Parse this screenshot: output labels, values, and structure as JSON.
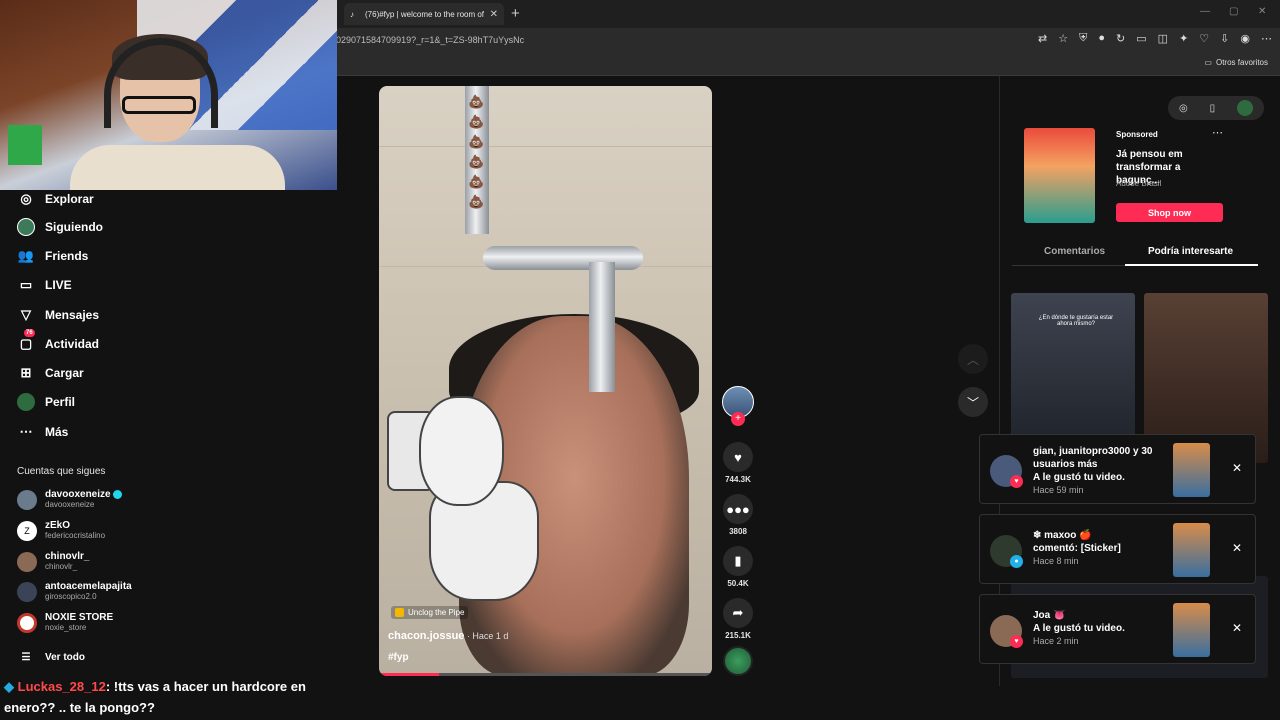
{
  "browser": {
    "tab_title": "(76)#fyp | welcome to the room of",
    "url": "029071584709919?_r=1&_t=ZS-98hT7uYysNc",
    "bookmarks_folder": "Otros favoritos"
  },
  "sidebar": {
    "items": [
      {
        "label": "Explorar",
        "icon": "compass-icon"
      },
      {
        "label": "Siguiendo",
        "icon": "following-avatar-icon"
      },
      {
        "label": "Friends",
        "icon": "friends-icon"
      },
      {
        "label": "LIVE",
        "icon": "live-icon"
      },
      {
        "label": "Mensajes",
        "icon": "messages-icon"
      },
      {
        "label": "Actividad",
        "icon": "activity-icon",
        "badge": "76"
      },
      {
        "label": "Cargar",
        "icon": "upload-icon"
      },
      {
        "label": "Perfil",
        "icon": "profile-avatar-icon"
      },
      {
        "label": "Más",
        "icon": "more-icon"
      }
    ],
    "following_title": "Cuentas que sigues",
    "accounts": [
      {
        "name": "davooxeneize",
        "handle": "davooxeneize",
        "verified": true
      },
      {
        "name": "zEkO",
        "handle": "federicocristalino",
        "verified": false
      },
      {
        "name": "chinovlr_",
        "handle": "chinovlr_",
        "verified": false
      },
      {
        "name": "antoacemelapajita",
        "handle": "giroscopico2.0",
        "verified": false
      },
      {
        "name": "NOXIE STORE",
        "handle": "noxie_store",
        "verified": false
      }
    ],
    "see_all": "Ver todo"
  },
  "chat": {
    "user": "Luckas_28_12",
    "message": ": !tts vas a hacer un hardcore en enero?? .. te la pongo??"
  },
  "video": {
    "effect": "Unclog the Pipe",
    "author": "chacon.jossue",
    "time": " · Hace 1 d",
    "hashtag": "#fyp",
    "progress": 0.18
  },
  "actions": {
    "likes": "744.3K",
    "comments": "3808",
    "saves": "50.4K",
    "shares": "215.1K"
  },
  "ad": {
    "label": "Sponsored",
    "text": "Já pensou em transformar a bagunç...",
    "brand": "Adobe Brasil",
    "cta": "Shop now"
  },
  "tabs": {
    "comments": "Comentarios",
    "interest": "Podría interesarte"
  },
  "thumbs": {
    "caption": "¿En dónde te gustaría estar ahora mismo?"
  },
  "notifications": [
    {
      "line1": "gian, juanitopro3000 y 30 usuarios más",
      "line2": "A le gustó tu video.",
      "time": "Hace 59 min"
    },
    {
      "line1": "❄ maxoo 🍎",
      "line2": "comentó: [Sticker]",
      "time": "Hace 8 min"
    },
    {
      "line1": "Joa 👅",
      "line2": "A le gustó tu video.",
      "time": "Hace 2 min"
    }
  ],
  "colors": {
    "accent": "#fe2c55",
    "verified": "#20d5ec"
  }
}
